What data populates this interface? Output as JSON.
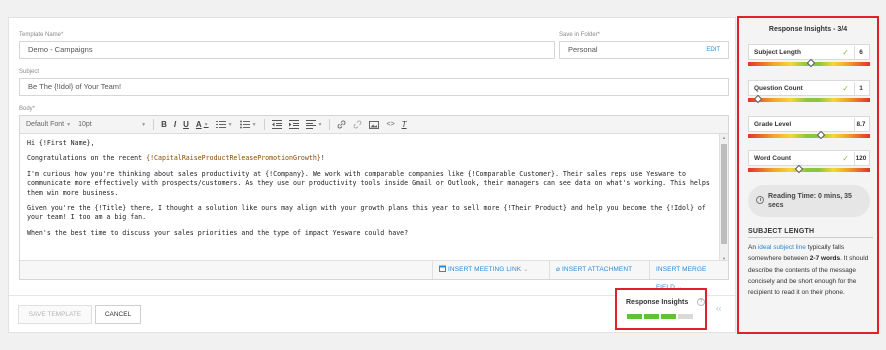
{
  "form": {
    "template_name_label": "Template Name*",
    "template_name_value": "Demo - Campaigns",
    "save_folder_label": "Save in Folder*",
    "save_folder_value": "Personal",
    "save_folder_edit": "EDIT",
    "subject_label": "Subject",
    "subject_value": "Be The {!Idol} of Your Team!",
    "body_label": "Body*"
  },
  "toolbar": {
    "font": "Default Font",
    "size": "10pt",
    "bold_icon": "B",
    "italic_icon": "I",
    "underline_icon": "U",
    "font_color_icon": "A",
    "clear_format_icon": "T",
    "icons": [
      "ordered-list-icon",
      "bullet-list-icon",
      "outdent-icon",
      "indent-icon",
      "align-icon",
      "link-icon",
      "unlink-icon",
      "image-icon",
      "code-icon",
      "clear-format-icon"
    ]
  },
  "email_body": {
    "greeting": "Hi {!First Name},",
    "p1_prefix": "Congratulations on the recent ",
    "p1_merge": "{!CapitalRaiseProductReleasePromotionGrowth}",
    "p1_suffix": "!",
    "p2": "I'm curious how you're thinking about sales productivity at {!Company}. We work with comparable companies like {!Comparable Customer}. Their sales reps use Yesware to communicate more effectively with prospects/customers. As they use our productivity tools inside Gmail or Outlook, their managers can see data on what's working. This helps them win more business.",
    "p3": "Given you're the {!Title} there, I thought a solution like ours may align with your growth plans this year to sell more {!Their Product} and help you become the {!Idol} of your team! I too am a big fan.",
    "p4": "When's the best time to discuss your sales priorities and the type of impact Yesware could have?"
  },
  "editor_actions": {
    "insert_meeting_link": "INSERT MEETING LINK",
    "insert_attachment": "INSERT ATTACHMENT",
    "insert_merge_field": "INSERT MERGE FIELD"
  },
  "footer": {
    "save_template": "SAVE TEMPLATE",
    "cancel": "CANCEL"
  },
  "mini_insights": {
    "label": "Response Insights",
    "score": 3,
    "max": 4
  },
  "insights_panel": {
    "title": "Response Insights - 3/4",
    "metrics": [
      {
        "name": "Subject Length",
        "value": "6",
        "ok": true,
        "marker_fraction": 0.52
      },
      {
        "name": "Question Count",
        "value": "1",
        "ok": true,
        "marker_fraction": 0.08
      },
      {
        "name": "Grade Level",
        "value": "8.7",
        "ok": false,
        "marker_fraction": 0.6
      },
      {
        "name": "Word Count",
        "value": "120",
        "ok": true,
        "marker_fraction": 0.42
      }
    ],
    "reading_time": "Reading Time: 0 mins, 35 secs",
    "section_title": "SUBJECT LENGTH",
    "desc_prefix": "An ",
    "desc_link": "ideal subject line",
    "desc_mid": " typically falls somewhere between ",
    "desc_bold": "2-7 words",
    "desc_suffix": ". It should describe the contents of the message concisely and be short enough for the recipient to read it on their phone."
  },
  "colors": {
    "accent": "#2b8ad6",
    "highlight_border": "#e0202a",
    "ok_green": "#7cc142"
  }
}
